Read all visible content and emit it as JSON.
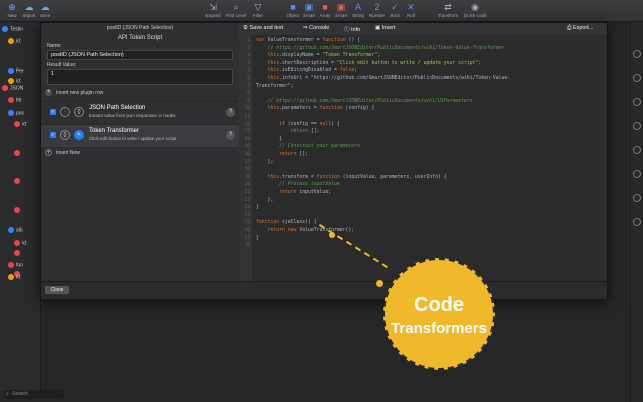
{
  "toolbar": {
    "left": [
      {
        "label": "New",
        "icon": "plus-icon"
      },
      {
        "label": "Import",
        "icon": "import-icon"
      },
      {
        "label": "Save",
        "icon": "save-icon"
      }
    ],
    "right": [
      {
        "label": "Expand",
        "icon": "expand-icon"
      },
      {
        "label": "Find Level",
        "icon": "find-level-icon"
      },
      {
        "label": "Filter",
        "icon": "filter-icon"
      },
      {
        "label": "Object",
        "icon": "object-icon"
      },
      {
        "label": "Smart",
        "icon": "smart-icon"
      },
      {
        "label": "Array",
        "icon": "array-icon"
      },
      {
        "label": "Smart",
        "icon": "smart-icon"
      },
      {
        "label": "String",
        "icon": "string-icon"
      },
      {
        "label": "Number",
        "icon": "number-icon"
      },
      {
        "label": "Bool",
        "icon": "bool-icon"
      },
      {
        "label": "Null",
        "icon": "null-icon"
      },
      {
        "label": "Transform",
        "icon": "transform-icon"
      },
      {
        "label": "Quick Look",
        "icon": "quick-look-icon"
      }
    ]
  },
  "tree": [
    {
      "label": "Testin",
      "color": "#3b82f6"
    },
    {
      "label": "id:",
      "color": "#f59e0b"
    },
    {
      "label": "Per",
      "color": "#3b82f6"
    },
    {
      "label": "id:",
      "color": "#f59e0b"
    },
    {
      "label": "JSON",
      "color": "#ef4444"
    },
    {
      "label": "Ite",
      "color": "#ef4444"
    },
    {
      "label": "pos",
      "color": "#3b82f6"
    },
    {
      "label": "id:",
      "color": "#ef4444"
    },
    {
      "label": "",
      "color": "#ef4444"
    },
    {
      "label": "",
      "color": "#ef4444"
    },
    {
      "label": "",
      "color": "#ef4444"
    },
    {
      "label": "alb",
      "color": "#3b82f6"
    },
    {
      "label": "id:",
      "color": "#ef4444"
    },
    {
      "label": "",
      "color": "#ef4444"
    },
    {
      "label": "",
      "color": "#ef4444"
    },
    {
      "label": "foo",
      "color": "#ef4444"
    },
    {
      "label": "id:",
      "color": "#f59e0b"
    }
  ],
  "search": {
    "placeholder": "Search"
  },
  "dialog": {
    "title": "postID (JSON Path Selection)",
    "subtitle": "API Token Script",
    "name_label": "Name:",
    "name_value": "postID (JSON Path Selection)",
    "result_label": "Result Value:",
    "result_value": "1",
    "insert_plugin": "Insert new plugin row",
    "plugins": [
      {
        "name": "JSON Path Selection",
        "desc": "Extract value from json responses or nodes"
      },
      {
        "name": "Token Transformer",
        "desc": "Click edit button to write / update your script"
      }
    ],
    "insert_new": "Insert New",
    "close": "Close"
  },
  "editor_toolbar": {
    "save": "Save and test",
    "console": "Console",
    "info": "Info",
    "insert": "Insert",
    "export": "Export..."
  },
  "code_lines": [
    "var ValueTransformer = function () {",
    "    // https://github.com/SmartJSONEditor/PublicDocuments/wiki/Token-Value-Transformer",
    "    this.displayName = \"Token Transformer\";",
    "    this.shortDescription = \"Click edit button to write / update your script\";",
    "    this.isEditingDisabled = false;",
    "    this.infoUrl = \"https://github.com/SmartJSONEditor/PublicDocuments/wiki/Token-Value-",
    "Transformer\";",
    "",
    "    // https://github.com/SmartJSONEditor/PublicDocuments/wiki/UIParameters",
    "    this.parameters = function (config) {",
    "",
    "        if (config == null) {",
    "            return [];",
    "        }",
    "        // Construct your parameters",
    "        return [];",
    "    };",
    "",
    "    this.transform = function (inputValue, parameters, userInfo) {",
    "        // Process inputValue",
    "        return inputValue;",
    "    };",
    "}",
    "",
    "function sjeClass() {",
    "    return new ValueTransformer();",
    "}",
    ""
  ],
  "promo": {
    "line1": "Code",
    "line2": "Transformers"
  },
  "colors": {
    "accent": "#f0b92b",
    "selection": "#2f7df6"
  }
}
